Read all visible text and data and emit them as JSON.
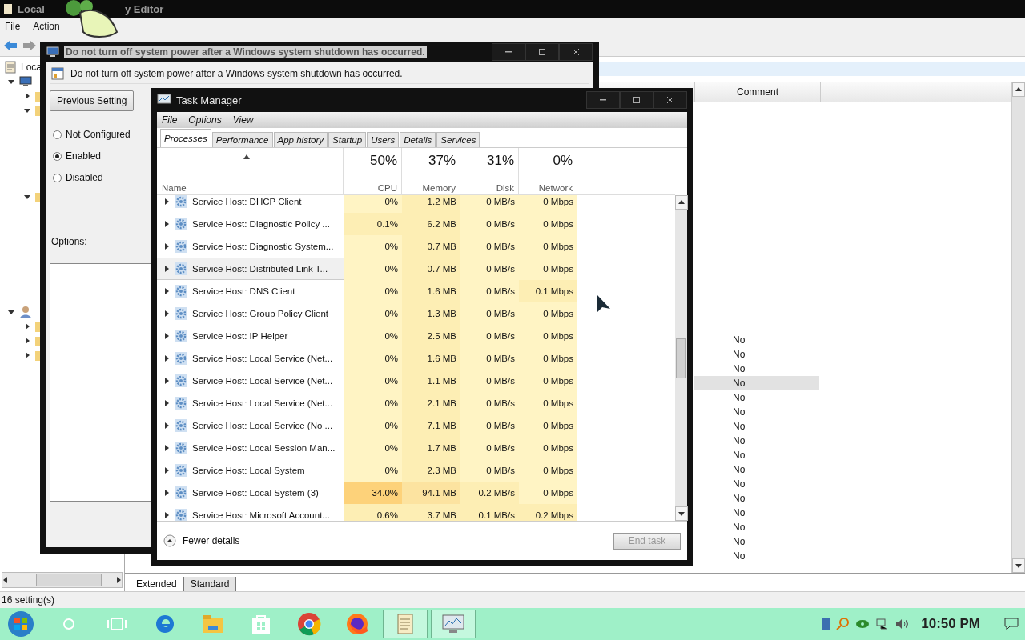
{
  "editor": {
    "title_parts": [
      "Local",
      "y Editor"
    ],
    "menu": [
      "File",
      "Action"
    ],
    "tree": [
      {
        "label": "Loca",
        "kind": "document",
        "children": [
          {
            "kind": "computer",
            "expanded": true,
            "children": [
              {
                "kind": "folder",
                "expanded": false
              },
              {
                "kind": "folder",
                "expanded": true
              },
              {
                "kind": "folder",
                "expanded": true
              }
            ]
          },
          {
            "kind": "user",
            "expanded": true,
            "children": [
              {
                "kind": "folder",
                "expanded": false
              },
              {
                "kind": "folder",
                "expanded": false
              },
              {
                "kind": "folder",
                "expanded": false
              }
            ]
          }
        ]
      }
    ],
    "column": "Comment",
    "rows": [
      {
        "value": "No",
        "selected": false
      },
      {
        "value": "No",
        "selected": false
      },
      {
        "value": "No",
        "selected": false
      },
      {
        "value": "No",
        "selected": true
      },
      {
        "value": "No",
        "selected": false
      },
      {
        "value": "No",
        "selected": false
      },
      {
        "value": "No",
        "selected": false
      },
      {
        "value": "No",
        "selected": false
      },
      {
        "value": "No",
        "selected": false
      },
      {
        "value": "No",
        "selected": false
      },
      {
        "value": "No",
        "selected": false
      },
      {
        "value": "No",
        "selected": false
      },
      {
        "value": "No",
        "selected": false
      },
      {
        "value": "No",
        "selected": false
      },
      {
        "value": "No",
        "selected": false
      },
      {
        "value": "No",
        "selected": false
      }
    ],
    "view_tabs": [
      {
        "label": "Extended",
        "selected": true
      },
      {
        "label": "Standard",
        "selected": false
      }
    ],
    "status": "16 setting(s)"
  },
  "policy_dialog": {
    "title": "Do not turn off system power after a Windows system shutdown has occurred.",
    "heading": "Do not turn off system power after a Windows system shutdown has occurred.",
    "button": "Previous Setting",
    "choices": [
      {
        "label": "Not Configured",
        "selected": false
      },
      {
        "label": "Enabled",
        "selected": true
      },
      {
        "label": "Disabled",
        "selected": false
      }
    ],
    "options_label": "Options:"
  },
  "task_manager": {
    "title": "Task Manager",
    "menu": [
      "File",
      "Options",
      "View"
    ],
    "tabs": [
      {
        "label": "Processes",
        "selected": true
      },
      {
        "label": "Performance",
        "selected": false
      },
      {
        "label": "App history",
        "selected": false
      },
      {
        "label": "Startup",
        "selected": false
      },
      {
        "label": "Users",
        "selected": false
      },
      {
        "label": "Details",
        "selected": false
      },
      {
        "label": "Services",
        "selected": false
      }
    ],
    "name_column": "Name",
    "columns": [
      {
        "total": "50%",
        "label": "CPU"
      },
      {
        "total": "37%",
        "label": "Memory"
      },
      {
        "total": "31%",
        "label": "Disk"
      },
      {
        "total": "0%",
        "label": "Network"
      }
    ],
    "rows": [
      {
        "name": "Service Host: DHCP Client",
        "selected": false,
        "cells": [
          {
            "text": "0%",
            "color": "#fff4c4"
          },
          {
            "text": "1.2 MB",
            "color": "#fdeeb4"
          },
          {
            "text": "0 MB/s",
            "color": "#fff4c4"
          },
          {
            "text": "0 Mbps",
            "color": "#fff4c4"
          }
        ]
      },
      {
        "name": "Service Host: Diagnostic Policy ...",
        "selected": false,
        "cells": [
          {
            "text": "0.1%",
            "color": "#fdeeb4"
          },
          {
            "text": "6.2 MB",
            "color": "#fdeeb4"
          },
          {
            "text": "0 MB/s",
            "color": "#fff4c4"
          },
          {
            "text": "0 Mbps",
            "color": "#fff4c4"
          }
        ]
      },
      {
        "name": "Service Host: Diagnostic System...",
        "selected": false,
        "cells": [
          {
            "text": "0%",
            "color": "#fff4c4"
          },
          {
            "text": "0.7 MB",
            "color": "#fdeeb4"
          },
          {
            "text": "0 MB/s",
            "color": "#fff4c4"
          },
          {
            "text": "0 Mbps",
            "color": "#fff4c4"
          }
        ]
      },
      {
        "name": "Service Host: Distributed Link T...",
        "selected": true,
        "cells": [
          {
            "text": "0%",
            "color": "#fff4c4"
          },
          {
            "text": "0.7 MB",
            "color": "#fdeeb4"
          },
          {
            "text": "0 MB/s",
            "color": "#fff4c4"
          },
          {
            "text": "0 Mbps",
            "color": "#fff4c4"
          }
        ]
      },
      {
        "name": "Service Host: DNS Client",
        "selected": false,
        "cells": [
          {
            "text": "0%",
            "color": "#fff4c4"
          },
          {
            "text": "1.6 MB",
            "color": "#fdeeb4"
          },
          {
            "text": "0 MB/s",
            "color": "#fff4c4"
          },
          {
            "text": "0.1 Mbps",
            "color": "#fdeeb4"
          }
        ]
      },
      {
        "name": "Service Host: Group Policy Client",
        "selected": false,
        "cells": [
          {
            "text": "0%",
            "color": "#fff4c4"
          },
          {
            "text": "1.3 MB",
            "color": "#fdeeb4"
          },
          {
            "text": "0 MB/s",
            "color": "#fff4c4"
          },
          {
            "text": "0 Mbps",
            "color": "#fff4c4"
          }
        ]
      },
      {
        "name": "Service Host: IP Helper",
        "selected": false,
        "cells": [
          {
            "text": "0%",
            "color": "#fff4c4"
          },
          {
            "text": "2.5 MB",
            "color": "#fdeeb4"
          },
          {
            "text": "0 MB/s",
            "color": "#fff4c4"
          },
          {
            "text": "0 Mbps",
            "color": "#fff4c4"
          }
        ]
      },
      {
        "name": "Service Host: Local Service (Net...",
        "selected": false,
        "cells": [
          {
            "text": "0%",
            "color": "#fff4c4"
          },
          {
            "text": "1.6 MB",
            "color": "#fdeeb4"
          },
          {
            "text": "0 MB/s",
            "color": "#fff4c4"
          },
          {
            "text": "0 Mbps",
            "color": "#fff4c4"
          }
        ]
      },
      {
        "name": "Service Host: Local Service (Net...",
        "selected": false,
        "cells": [
          {
            "text": "0%",
            "color": "#fff4c4"
          },
          {
            "text": "1.1 MB",
            "color": "#fdeeb4"
          },
          {
            "text": "0 MB/s",
            "color": "#fff4c4"
          },
          {
            "text": "0 Mbps",
            "color": "#fff4c4"
          }
        ]
      },
      {
        "name": "Service Host: Local Service (Net...",
        "selected": false,
        "cells": [
          {
            "text": "0%",
            "color": "#fff4c4"
          },
          {
            "text": "2.1 MB",
            "color": "#fdeeb4"
          },
          {
            "text": "0 MB/s",
            "color": "#fff4c4"
          },
          {
            "text": "0 Mbps",
            "color": "#fff4c4"
          }
        ]
      },
      {
        "name": "Service Host: Local Service (No ...",
        "selected": false,
        "cells": [
          {
            "text": "0%",
            "color": "#fff4c4"
          },
          {
            "text": "7.1 MB",
            "color": "#fdeeb4"
          },
          {
            "text": "0 MB/s",
            "color": "#fff4c4"
          },
          {
            "text": "0 Mbps",
            "color": "#fff4c4"
          }
        ]
      },
      {
        "name": "Service Host: Local Session Man...",
        "selected": false,
        "cells": [
          {
            "text": "0%",
            "color": "#fff4c4"
          },
          {
            "text": "1.7 MB",
            "color": "#fdeeb4"
          },
          {
            "text": "0 MB/s",
            "color": "#fff4c4"
          },
          {
            "text": "0 Mbps",
            "color": "#fff4c4"
          }
        ]
      },
      {
        "name": "Service Host: Local System",
        "selected": false,
        "cells": [
          {
            "text": "0%",
            "color": "#fff4c4"
          },
          {
            "text": "2.3 MB",
            "color": "#fdeeb4"
          },
          {
            "text": "0 MB/s",
            "color": "#fff4c4"
          },
          {
            "text": "0 Mbps",
            "color": "#fff4c4"
          }
        ]
      },
      {
        "name": "Service Host: Local System (3)",
        "selected": false,
        "cells": [
          {
            "text": "34.0%",
            "color": "#fdd27a"
          },
          {
            "text": "94.1 MB",
            "color": "#fce3a0"
          },
          {
            "text": "0.2 MB/s",
            "color": "#fdeeb4"
          },
          {
            "text": "0 Mbps",
            "color": "#fff4c4"
          }
        ]
      },
      {
        "name": "Service Host: Microsoft Account...",
        "selected": false,
        "cells": [
          {
            "text": "0.6%",
            "color": "#fdeeb4"
          },
          {
            "text": "3.7 MB",
            "color": "#fdeeb4"
          },
          {
            "text": "0.1 MB/s",
            "color": "#fdeeb4"
          },
          {
            "text": "0.2 Mbps",
            "color": "#fdeeb4"
          }
        ]
      }
    ],
    "fewer_details": "Fewer details",
    "end_task": {
      "label": "End task",
      "disabled": true
    }
  },
  "taskbar": {
    "apps": [
      {
        "kind": "cortana",
        "active": false
      },
      {
        "kind": "taskview",
        "active": false
      },
      {
        "kind": "edge",
        "active": false
      },
      {
        "kind": "explorer",
        "active": false
      },
      {
        "kind": "store",
        "active": false
      },
      {
        "kind": "chrome",
        "active": false
      },
      {
        "kind": "firefox",
        "active": false
      },
      {
        "kind": "notepad",
        "active": true
      },
      {
        "kind": "monitor",
        "active": true
      }
    ],
    "clock": "10:50 PM"
  }
}
